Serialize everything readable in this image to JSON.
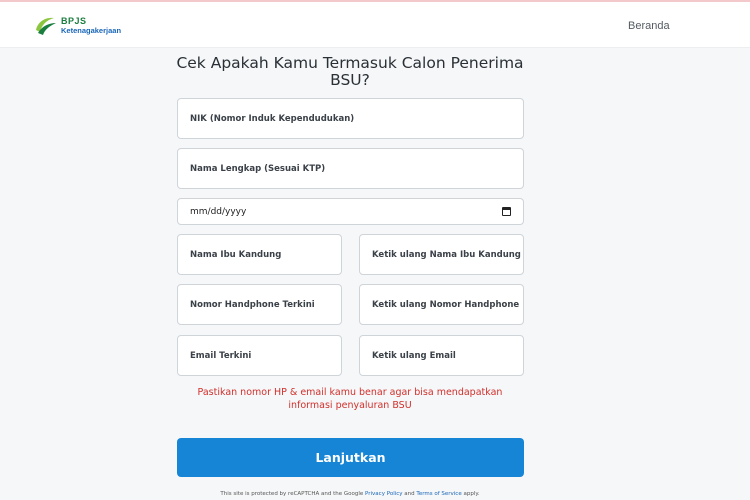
{
  "header": {
    "logo_main": "BPJS",
    "logo_sub": "Ketenagakerjaan",
    "nav_home": "Beranda"
  },
  "form": {
    "title": "Cek Apakah Kamu Termasuk Calon Penerima BSU?",
    "nik_placeholder": "NIK (Nomor Induk Kependudukan)",
    "name_placeholder": "Nama Lengkap (Sesuai KTP)",
    "dob_placeholder": "mm/dd/yyyy",
    "mother_placeholder": "Nama Ibu Kandung",
    "mother_confirm_placeholder": "Ketik ulang Nama Ibu Kandung",
    "phone_placeholder": "Nomor Handphone Terkini",
    "phone_confirm_placeholder": "Ketik ulang Nomor Handphone",
    "email_placeholder": "Email Terkini",
    "email_confirm_placeholder": "Ketik ulang Email",
    "warning": "Pastikan nomor HP & email kamu benar agar bisa mendapatkan informasi penyaluran BSU",
    "submit_label": "Lanjutkan"
  },
  "recaptcha": {
    "prefix": "This site is protected by reCAPTCHA and the Google",
    "privacy": "Privacy Policy",
    "and": "and",
    "terms": "Terms of Service",
    "suffix": "apply."
  },
  "colors": {
    "primary": "#1685d6",
    "warning": "#d0312d",
    "logo_green": "#1a7e3f",
    "logo_blue": "#1a66b8"
  }
}
